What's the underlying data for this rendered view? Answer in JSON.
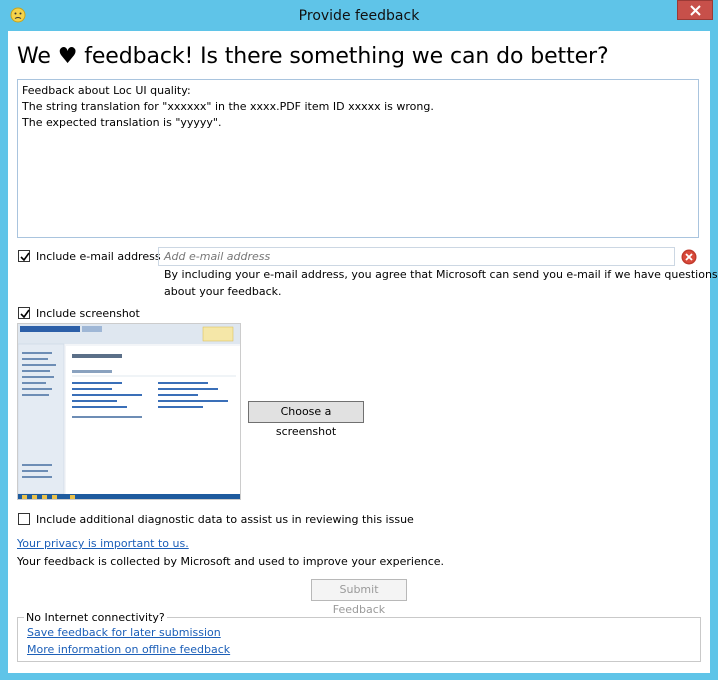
{
  "window": {
    "title": "Provide feedback",
    "icon": "sad-face-icon"
  },
  "heading": "We ♥ feedback! Is there something we can do better?",
  "feedback": {
    "lines": [
      "Feedback about Loc UI quality:",
      "The string translation for \"xxxxxx\" in the xxxx.PDF item ID xxxxx is wrong.",
      "The expected translation is \"yyyyy\"."
    ]
  },
  "email": {
    "checkbox_label": "Include e-mail address",
    "checked": true,
    "placeholder": "Add e-mail address",
    "notice_line1": "By including your e-mail address, you agree that Microsoft can send you e-mail if we have questions",
    "notice_line2": "about your feedback."
  },
  "screenshot": {
    "checkbox_label": "Include screenshot",
    "checked": true,
    "choose_button": "Choose a screenshot"
  },
  "diagnostics": {
    "checkbox_label": "Include additional diagnostic data to assist us in reviewing this issue",
    "checked": false
  },
  "privacy": {
    "link": "Your privacy is important to us.",
    "text": "Your feedback is collected by Microsoft and used to improve your experience."
  },
  "submit_button": "Submit Feedback",
  "offline": {
    "legend": "No Internet connectivity?",
    "save_link": "Save feedback for later submission",
    "info_link": "More information on offline feedback"
  }
}
